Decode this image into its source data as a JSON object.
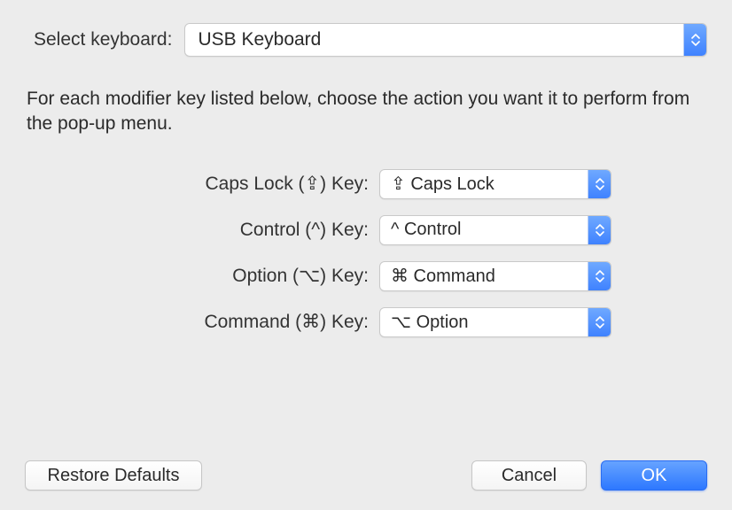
{
  "header": {
    "selectKeyboardLabel": "Select keyboard:",
    "selectedKeyboard": "USB Keyboard"
  },
  "description": "For each modifier key listed below, choose the action you want it to perform from the pop-up menu.",
  "modifiers": {
    "capsLock": {
      "label": "Caps Lock (⇪) Key:",
      "value": "⇪ Caps Lock"
    },
    "control": {
      "label": "Control (^) Key:",
      "value": "^ Control"
    },
    "option": {
      "label": "Option (⌥) Key:",
      "value": "⌘ Command"
    },
    "command": {
      "label": "Command (⌘) Key:",
      "value": "⌥ Option"
    }
  },
  "buttons": {
    "restore": "Restore Defaults",
    "cancel": "Cancel",
    "ok": "OK"
  }
}
